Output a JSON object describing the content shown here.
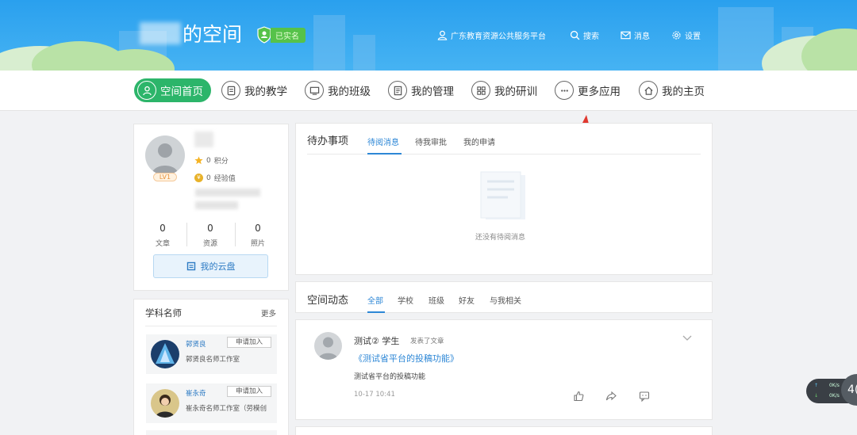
{
  "header": {
    "space_title": "的空间",
    "verified_label": "已实名",
    "nav": [
      {
        "label": "广东教育资源公共服务平台",
        "icon": "user-icon"
      },
      {
        "label": "搜索",
        "icon": "search-icon"
      },
      {
        "label": "消息",
        "icon": "mail-icon"
      },
      {
        "label": "设置",
        "icon": "gear-icon"
      }
    ]
  },
  "main_nav": [
    {
      "label": "空间首页",
      "icon": "person-icon",
      "active": true
    },
    {
      "label": "我的教学",
      "icon": "book-icon"
    },
    {
      "label": "我的班级",
      "icon": "monitor-icon"
    },
    {
      "label": "我的管理",
      "icon": "document-icon"
    },
    {
      "label": "我的研训",
      "icon": "grid-icon"
    },
    {
      "label": "更多应用",
      "icon": "more-icon"
    },
    {
      "label": "我的主页",
      "icon": "home-icon"
    }
  ],
  "profile": {
    "level": "LV1",
    "points_value": "0",
    "points_label": "积分",
    "exp_value": "0",
    "exp_label": "经验值",
    "stats": [
      {
        "num": "0",
        "label": "文章"
      },
      {
        "num": "0",
        "label": "资源"
      },
      {
        "num": "0",
        "label": "照片"
      }
    ],
    "cloud_button": "我的云盘"
  },
  "teachers": {
    "title": "学科名师",
    "more": "更多",
    "join_label": "申请加入",
    "items": [
      {
        "name": "郭贤良",
        "studio": "郭贤良名师工作室"
      },
      {
        "name": "崔永奇",
        "studio": "崔永奇名师工作室（劳模创"
      }
    ]
  },
  "todo": {
    "title": "待办事项",
    "tabs": [
      "待阅消息",
      "待我审批",
      "我的申请"
    ],
    "empty_text": "还没有待阅消息"
  },
  "feed": {
    "title": "空间动态",
    "tabs": [
      "全部",
      "学校",
      "班级",
      "好友",
      "与我相关"
    ],
    "post": {
      "user": "测试② 学生",
      "action": "发表了文章",
      "link": "《测试省平台的投稿功能》",
      "body": "测试省平台的投稿功能",
      "time": "10-17 10:41"
    }
  },
  "speed_widget": {
    "up": "0K/s",
    "down": "0K/s",
    "badge": "4("
  },
  "colors": {
    "banner": "#2aa0ee",
    "active_nav": "#2cb56a",
    "link": "#2d87d6",
    "annotation_arrow": "#e0382f"
  }
}
